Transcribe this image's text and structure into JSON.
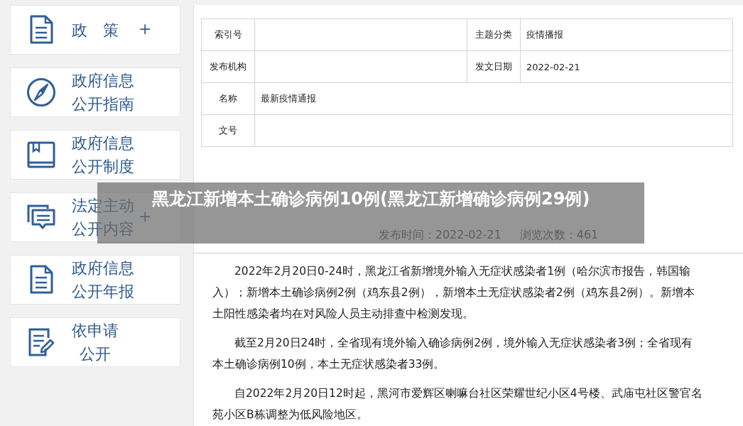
{
  "sidebar": {
    "items": [
      {
        "kind": "document",
        "lines": [
          "政　策"
        ],
        "expander": "+"
      },
      {
        "kind": "compass",
        "lines": [
          "政府信息",
          "公开指南"
        ]
      },
      {
        "kind": "book",
        "lines": [
          "政府信息",
          "公开制度"
        ]
      },
      {
        "kind": "chat",
        "lines": [
          "法定主动",
          "公开内容"
        ],
        "expander": "+"
      },
      {
        "kind": "document",
        "lines": [
          "政府信息",
          "公开年报"
        ]
      },
      {
        "kind": "edit",
        "lines": [
          "依申请",
          "公开"
        ]
      }
    ]
  },
  "info_table": {
    "rows": [
      {
        "cells": [
          {
            "label": "索引号"
          },
          {
            "label": "主题分类",
            "value": "疫情播报"
          }
        ]
      },
      {
        "cells": [
          {
            "label": "发布机构"
          },
          {
            "label": "发文日期",
            "value": "2022-02-21"
          }
        ]
      },
      {
        "cells": [
          {
            "label": "名称",
            "value": "最新疫情通报"
          }
        ]
      },
      {
        "cells": [
          {
            "label": "文号"
          }
        ]
      }
    ]
  },
  "article": {
    "meta": [
      "发布时间：2022-02-21",
      "浏览次数：461"
    ],
    "paragraphs": [
      "2022年2月20日0-24时，黑龙江省新增境外输入无症状感染者1例（哈尔滨市报告，韩国输入）；新增本土确诊病例2例（鸡东县2例），新增本土无症状感染者2例（鸡东县2例）。新增本土阳性感染者均在对风险人员主动排查中检测发现。",
      "截至2月20日24时，全省现有境外输入确诊病例2例，境外输入无症状感染者3例；全省现有本土确诊病例10例，本土无症状感染者33例。",
      "自2022年2月20日12时起，黑河市爱辉区喇嘛台社区荣耀世纪小区4号楼、武庙屯社区警官名苑小区B栋调整为低风险地区。"
    ]
  },
  "overlay_title": "黑龙江新增本土确诊病例10例(黑龙江新增确诊病例29例)"
}
